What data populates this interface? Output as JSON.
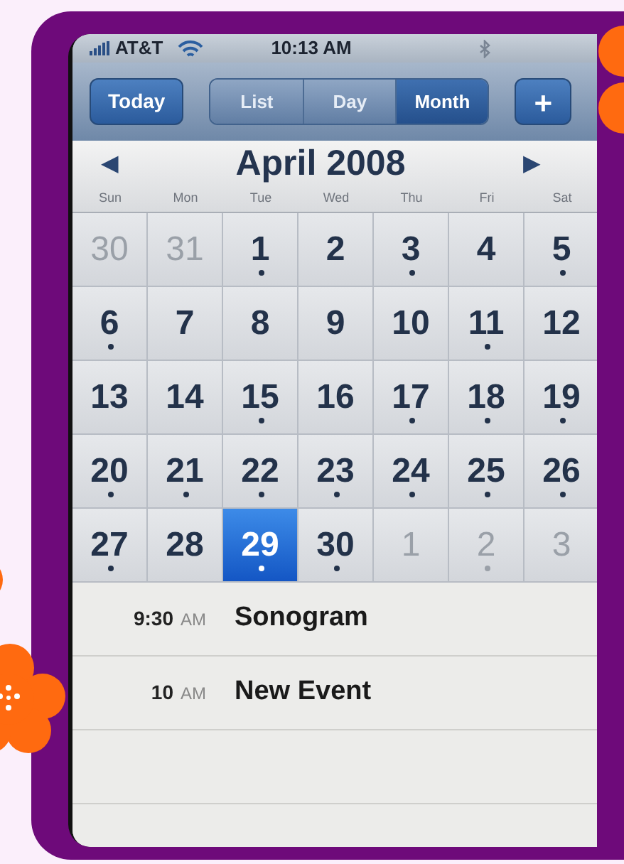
{
  "status_bar": {
    "carrier": "AT&T",
    "time": "10:13 AM"
  },
  "toolbar": {
    "today_button": "Today",
    "add_button": "+",
    "tabs": [
      {
        "label": "List",
        "selected": false
      },
      {
        "label": "Day",
        "selected": false
      },
      {
        "label": "Month",
        "selected": true
      }
    ]
  },
  "calendar": {
    "month_title": "April 2008",
    "prev": "◀",
    "next": "▶",
    "weekdays": [
      "Sun",
      "Mon",
      "Tue",
      "Wed",
      "Thu",
      "Fri",
      "Sat"
    ],
    "days": [
      {
        "label": "30",
        "muted": true,
        "event": false,
        "selected": false
      },
      {
        "label": "31",
        "muted": true,
        "event": false,
        "selected": false
      },
      {
        "label": "1",
        "muted": false,
        "event": true,
        "selected": false
      },
      {
        "label": "2",
        "muted": false,
        "event": false,
        "selected": false
      },
      {
        "label": "3",
        "muted": false,
        "event": true,
        "selected": false
      },
      {
        "label": "4",
        "muted": false,
        "event": false,
        "selected": false
      },
      {
        "label": "5",
        "muted": false,
        "event": true,
        "selected": false
      },
      {
        "label": "6",
        "muted": false,
        "event": true,
        "selected": false
      },
      {
        "label": "7",
        "muted": false,
        "event": false,
        "selected": false
      },
      {
        "label": "8",
        "muted": false,
        "event": false,
        "selected": false
      },
      {
        "label": "9",
        "muted": false,
        "event": false,
        "selected": false
      },
      {
        "label": "10",
        "muted": false,
        "event": false,
        "selected": false
      },
      {
        "label": "11",
        "muted": false,
        "event": true,
        "selected": false
      },
      {
        "label": "12",
        "muted": false,
        "event": false,
        "selected": false
      },
      {
        "label": "13",
        "muted": false,
        "event": false,
        "selected": false
      },
      {
        "label": "14",
        "muted": false,
        "event": false,
        "selected": false
      },
      {
        "label": "15",
        "muted": false,
        "event": true,
        "selected": false
      },
      {
        "label": "16",
        "muted": false,
        "event": false,
        "selected": false
      },
      {
        "label": "17",
        "muted": false,
        "event": true,
        "selected": false
      },
      {
        "label": "18",
        "muted": false,
        "event": true,
        "selected": false
      },
      {
        "label": "19",
        "muted": false,
        "event": true,
        "selected": false
      },
      {
        "label": "20",
        "muted": false,
        "event": true,
        "selected": false
      },
      {
        "label": "21",
        "muted": false,
        "event": true,
        "selected": false
      },
      {
        "label": "22",
        "muted": false,
        "event": true,
        "selected": false
      },
      {
        "label": "23",
        "muted": false,
        "event": true,
        "selected": false
      },
      {
        "label": "24",
        "muted": false,
        "event": true,
        "selected": false
      },
      {
        "label": "25",
        "muted": false,
        "event": true,
        "selected": false
      },
      {
        "label": "26",
        "muted": false,
        "event": true,
        "selected": false
      },
      {
        "label": "27",
        "muted": false,
        "event": true,
        "selected": false
      },
      {
        "label": "28",
        "muted": false,
        "event": false,
        "selected": false
      },
      {
        "label": "29",
        "muted": false,
        "event": true,
        "selected": true
      },
      {
        "label": "30",
        "muted": false,
        "event": true,
        "selected": false
      },
      {
        "label": "1",
        "muted": true,
        "event": false,
        "selected": false
      },
      {
        "label": "2",
        "muted": true,
        "event": true,
        "selected": false
      },
      {
        "label": "3",
        "muted": true,
        "event": false,
        "selected": false
      }
    ]
  },
  "events": [
    {
      "time": "9:30",
      "period": "AM",
      "title": "Sonogram"
    },
    {
      "time": "10",
      "period": "AM",
      "title": "New Event"
    }
  ]
}
